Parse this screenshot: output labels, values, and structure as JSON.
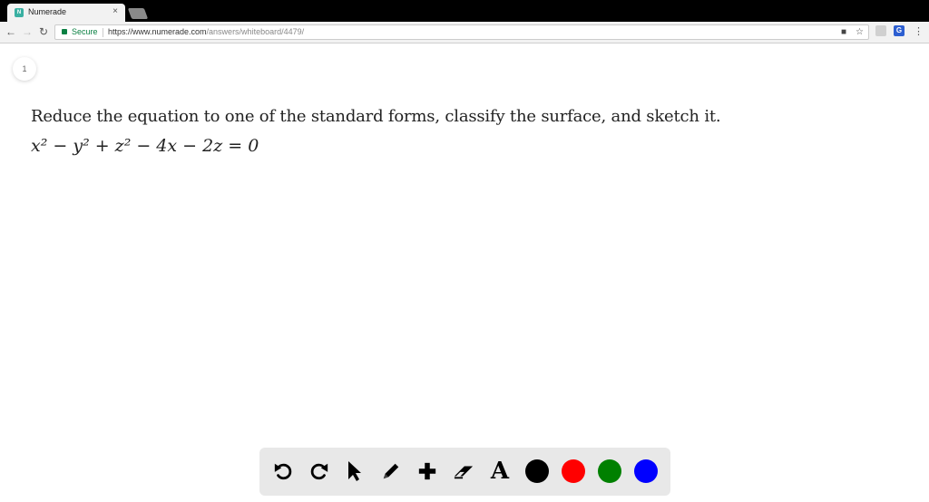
{
  "browser": {
    "tab_title": "Numerade",
    "tab_close": "×",
    "favicon_text": "N",
    "secure_label": "Secure",
    "url_host": "https://www.numerade.com",
    "url_path": "/answers/whiteboard/4479/"
  },
  "page": {
    "page_number": "1",
    "question": "Reduce the equation to one of the standard forms, classify the surface, and sketch it.",
    "equation": "x² − y² + z² − 4x − 2z = 0"
  },
  "whiteboard_toolbar": {
    "tools": [
      "undo-icon",
      "redo-icon",
      "pointer-icon",
      "pencil-icon",
      "plus-icon",
      "eraser-icon",
      "text-icon"
    ],
    "text_tool_label": "A",
    "colors": [
      "#000000",
      "#ff0000",
      "#008000",
      "#0000ff"
    ]
  }
}
